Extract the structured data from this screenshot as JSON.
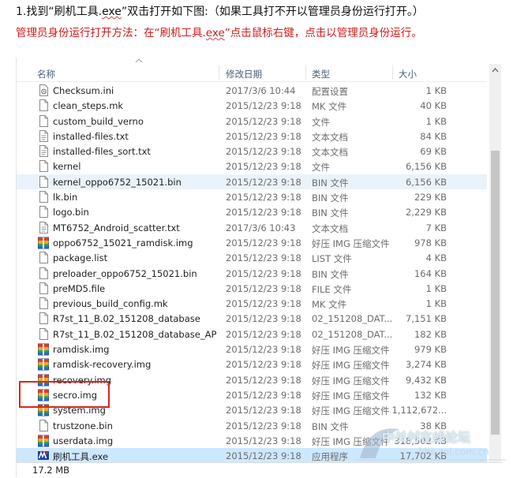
{
  "instructions": {
    "line1_prefix": "1.找到“刷机工具.",
    "line1_ext": "exe",
    "line1_suffix": "”双击打开如下图:（如果工具打不开以管理员身份运行打开。）",
    "line2_prefix": "管理员身份运行打开方法：在“刷机工具.",
    "line2_ext": "exe",
    "line2_suffix": "”点击鼠标右键，点击以管理员身份运行。"
  },
  "columns": {
    "name": "名称",
    "date": "修改日期",
    "type": "类型",
    "size": "大小"
  },
  "files": [
    {
      "name": "Checksum.ini",
      "date": "2017/3/6 10:44",
      "type": "配置设置",
      "size": "1 KB",
      "icon": "ini-icon"
    },
    {
      "name": "clean_steps.mk",
      "date": "2015/12/23 9:18",
      "type": "MK 文件",
      "size": "40 KB",
      "icon": "file-icon"
    },
    {
      "name": "custom_build_verno",
      "date": "2015/12/23 9:18",
      "type": "文件",
      "size": "1 KB",
      "icon": "file-icon"
    },
    {
      "name": "installed-files.txt",
      "date": "2015/12/23 9:18",
      "type": "文本文档",
      "size": "84 KB",
      "icon": "text-icon"
    },
    {
      "name": "installed-files_sort.txt",
      "date": "2015/12/23 9:18",
      "type": "文本文档",
      "size": "69 KB",
      "icon": "text-icon"
    },
    {
      "name": "kernel",
      "date": "2015/12/23 9:18",
      "type": "文件",
      "size": "6,156 KB",
      "icon": "file-icon"
    },
    {
      "name": "kernel_oppo6752_15021.bin",
      "date": "2015/12/23 9:18",
      "type": "BIN 文件",
      "size": "6,156 KB",
      "icon": "file-icon"
    },
    {
      "name": "lk.bin",
      "date": "2015/12/23 9:18",
      "type": "BIN 文件",
      "size": "229 KB",
      "icon": "file-icon"
    },
    {
      "name": "logo.bin",
      "date": "2015/12/23 9:18",
      "type": "BIN 文件",
      "size": "2,229 KB",
      "icon": "file-icon"
    },
    {
      "name": "MT6752_Android_scatter.txt",
      "date": "2017/3/6 10:43",
      "type": "文本文档",
      "size": "7 KB",
      "icon": "text-icon"
    },
    {
      "name": "oppo6752_15021_ramdisk.img",
      "date": "2015/12/23 9:18",
      "type": "好压 IMG 压缩文件",
      "size": "978 KB",
      "icon": "archive-icon"
    },
    {
      "name": "package.list",
      "date": "2015/12/23 9:18",
      "type": "LIST 文件",
      "size": "4 KB",
      "icon": "file-icon"
    },
    {
      "name": "preloader_oppo6752_15021.bin",
      "date": "2015/12/23 9:18",
      "type": "BIN 文件",
      "size": "164 KB",
      "icon": "file-icon"
    },
    {
      "name": "preMD5.file",
      "date": "2015/12/23 9:18",
      "type": "FILE 文件",
      "size": "1 KB",
      "icon": "file-icon"
    },
    {
      "name": "previous_build_config.mk",
      "date": "2015/12/23 9:18",
      "type": "MK 文件",
      "size": "1 KB",
      "icon": "file-icon"
    },
    {
      "name": "R7st_11_B.02_151208_database",
      "date": "2015/12/23 9:18",
      "type": "02_151208_DAT...",
      "size": "7,151 KB",
      "icon": "file-icon"
    },
    {
      "name": "R7st_11_B.02_151208_database_AP",
      "date": "2015/12/23 9:18",
      "type": "02_151208_DAT...",
      "size": "182 KB",
      "icon": "file-icon"
    },
    {
      "name": "ramdisk.img",
      "date": "2015/12/23 9:18",
      "type": "好压 IMG 压缩文件",
      "size": "979 KB",
      "icon": "archive-icon"
    },
    {
      "name": "ramdisk-recovery.img",
      "date": "2015/12/23 9:18",
      "type": "好压 IMG 压缩文件",
      "size": "3,274 KB",
      "icon": "archive-icon"
    },
    {
      "name": "recovery.img",
      "date": "2015/12/23 9:18",
      "type": "好压 IMG 压缩文件",
      "size": "9,432 KB",
      "icon": "archive-icon"
    },
    {
      "name": "secro.img",
      "date": "2015/12/23 9:18",
      "type": "好压 IMG 压缩文件",
      "size": "132 KB",
      "icon": "archive-icon"
    },
    {
      "name": "system.img",
      "date": "2015/12/23 9:18",
      "type": "好压 IMG 压缩文件",
      "size": "1,112,672...",
      "icon": "archive-icon"
    },
    {
      "name": "trustzone.bin",
      "date": "2015/12/23 9:18",
      "type": "BIN 文件",
      "size": "38 KB",
      "icon": "file-icon"
    },
    {
      "name": "userdata.img",
      "date": "2015/12/23 9:18",
      "type": "好压 IMG 压缩文件",
      "size": "318,502 KB",
      "icon": "archive-icon"
    },
    {
      "name": "刷机工具.exe",
      "date": "2015/12/23 9:18",
      "type": "应用程序",
      "size": "17,702 KB",
      "icon": "exe-icon"
    }
  ],
  "status": {
    "text": "17.2 MB"
  },
  "watermark": {
    "text": "中关村在线论坛",
    "url": "bbs.zol.com.cn"
  },
  "colors": {
    "selected": "#cce8ff",
    "highlight_box": "#d9261c",
    "instruction_red": "#d21a1a"
  }
}
